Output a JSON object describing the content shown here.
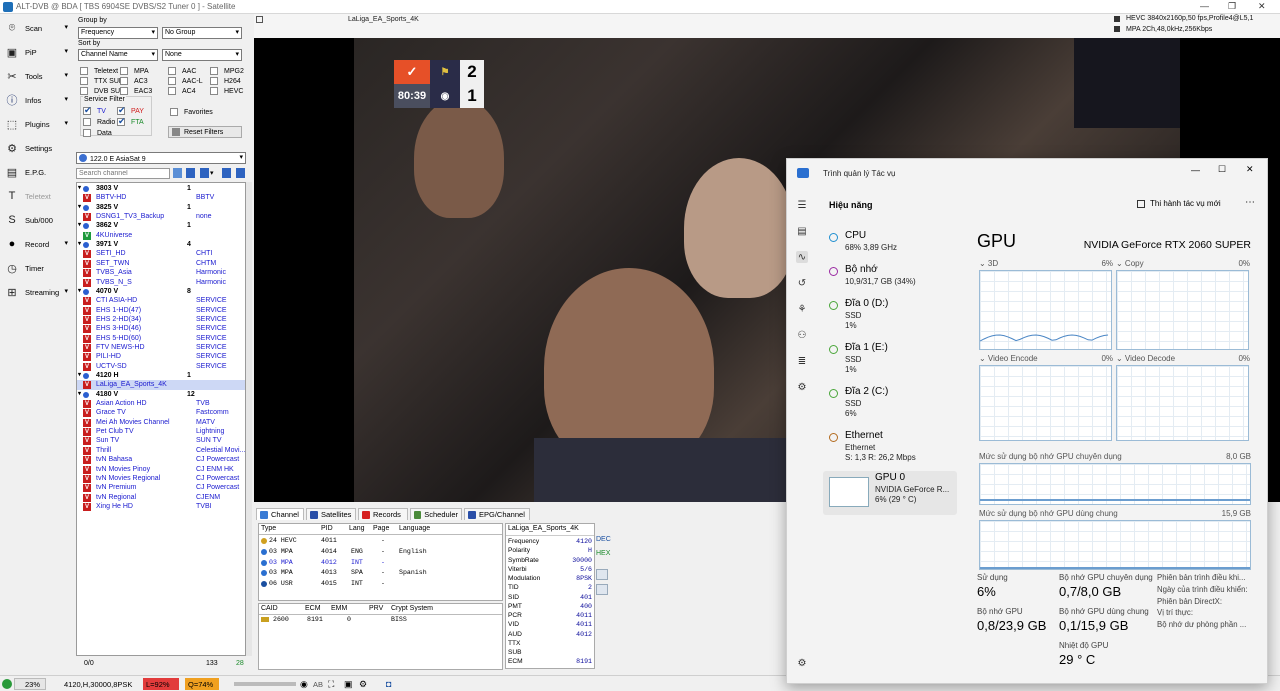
{
  "window": {
    "title": "ALT-DVB @ BDA [ TBS 6904SE DVBS/S2 Tuner 0 ] - Satellite"
  },
  "toolbar": [
    {
      "label": "Scan",
      "icon": "satellite-dish-icon",
      "arrow": true
    },
    {
      "label": "PiP",
      "icon": "pip-icon",
      "arrow": true
    },
    {
      "label": "Tools",
      "icon": "tools-icon",
      "arrow": true
    },
    {
      "label": "Infos",
      "icon": "info-icon",
      "arrow": true
    },
    {
      "label": "Plugins",
      "icon": "plugin-icon",
      "arrow": true
    },
    {
      "label": "Settings",
      "icon": "gear-icon",
      "arrow": false
    },
    {
      "label": "E.P.G.",
      "icon": "epg-icon",
      "arrow": false
    },
    {
      "label": "Teletext",
      "icon": "teletext-icon",
      "arrow": false,
      "disabled": true
    },
    {
      "label": "Sub/000",
      "icon": "subtitle-icon",
      "arrow": false
    },
    {
      "label": "Record",
      "icon": "record-icon",
      "arrow": true
    },
    {
      "label": "Timer",
      "icon": "clock-icon",
      "arrow": false
    },
    {
      "label": "Streaming",
      "icon": "network-icon",
      "arrow": true
    }
  ],
  "filters": {
    "group_by_label": "Group by",
    "group_by_value": "Frequency",
    "group_by_value2": "No Group",
    "sort_by_label": "Sort by",
    "sort_by_value": "Channel Name",
    "sort_by_value2": "None",
    "checks": [
      {
        "label": "Teletext",
        "col": 0,
        "row": 0
      },
      {
        "label": "TTX SUB",
        "col": 0,
        "row": 1
      },
      {
        "label": "DVB SUB",
        "col": 0,
        "row": 2
      },
      {
        "label": "MPA",
        "col": 1,
        "row": 0
      },
      {
        "label": "AC3",
        "col": 1,
        "row": 1
      },
      {
        "label": "EAC3",
        "col": 1,
        "row": 2
      },
      {
        "label": "AAC",
        "col": 2,
        "row": 0
      },
      {
        "label": "AAC-L",
        "col": 2,
        "row": 1
      },
      {
        "label": "AC4",
        "col": 2,
        "row": 2
      },
      {
        "label": "MPG2",
        "col": 3,
        "row": 0
      },
      {
        "label": "H264",
        "col": 3,
        "row": 1
      },
      {
        "label": "HEVC",
        "col": 3,
        "row": 2
      }
    ],
    "service_filter_label": "Service Filter",
    "service": [
      {
        "label": "TV",
        "checked": true,
        "color": "#1a1acf"
      },
      {
        "label": "PAY",
        "checked": true,
        "color": "#d01c1c"
      },
      {
        "label": "Radio",
        "checked": false,
        "color": "#000000"
      },
      {
        "label": "FTA",
        "checked": true,
        "color": "#1a8a2a"
      },
      {
        "label": "Data",
        "checked": false,
        "color": "#000000"
      }
    ],
    "favorites_label": "Favorites",
    "reset_label": "Reset Filters"
  },
  "satellite": {
    "value": "122.0 E AsiaSat 9"
  },
  "search": {
    "placeholder": "Search channel"
  },
  "channels": [
    {
      "type": "group",
      "name": "3803 V",
      "count": "1"
    },
    {
      "type": "ch",
      "tag": "V",
      "name": "BBTV-HD",
      "provider": "BBTV"
    },
    {
      "type": "group",
      "name": "3825 V",
      "count": "1"
    },
    {
      "type": "ch",
      "tag": "V",
      "name": "DSNG1_TV3_Backup",
      "provider": "none"
    },
    {
      "type": "group",
      "name": "3862 V",
      "count": "1"
    },
    {
      "type": "ch",
      "tag": "TV",
      "name": "4KUniverse",
      "provider": ""
    },
    {
      "type": "group",
      "name": "3971 V",
      "count": "4"
    },
    {
      "type": "ch",
      "tag": "V",
      "name": "SETI_HD",
      "provider": "CHTI"
    },
    {
      "type": "ch",
      "tag": "V",
      "name": "SET_TWN",
      "provider": "CHTM"
    },
    {
      "type": "ch",
      "tag": "V",
      "name": "TVBS_Asia",
      "provider": "Harmonic"
    },
    {
      "type": "ch",
      "tag": "V",
      "name": "TVBS_N_S",
      "provider": "Harmonic"
    },
    {
      "type": "group",
      "name": "4070 V",
      "count": "8"
    },
    {
      "type": "ch",
      "tag": "V",
      "name": "CTI ASIA-HD",
      "provider": "SERVICE"
    },
    {
      "type": "ch",
      "tag": "V",
      "name": "EHS 1-HD(47)",
      "provider": "SERVICE"
    },
    {
      "type": "ch",
      "tag": "V",
      "name": "EHS 2-HD(34)",
      "provider": "SERVICE"
    },
    {
      "type": "ch",
      "tag": "V",
      "name": "EHS 3-HD(46)",
      "provider": "SERVICE"
    },
    {
      "type": "ch",
      "tag": "V",
      "name": "EHS 5-HD(60)",
      "provider": "SERVICE"
    },
    {
      "type": "ch",
      "tag": "V",
      "name": "FTV NEWS-HD",
      "provider": "SERVICE"
    },
    {
      "type": "ch",
      "tag": "V",
      "name": "PILI-HD",
      "provider": "SERVICE"
    },
    {
      "type": "ch",
      "tag": "V",
      "name": "UCTV-SD",
      "provider": "SERVICE"
    },
    {
      "type": "group",
      "name": "4120 H",
      "count": "1"
    },
    {
      "type": "ch",
      "tag": "V",
      "name": "LaLiga_EA_Sports_4K",
      "provider": "",
      "selected": true
    },
    {
      "type": "group",
      "name": "4180 V",
      "count": "12"
    },
    {
      "type": "ch",
      "tag": "V",
      "name": "Asian Action HD",
      "provider": "TVB"
    },
    {
      "type": "ch",
      "tag": "V",
      "name": "Grace TV",
      "provider": "Fastcomm"
    },
    {
      "type": "ch",
      "tag": "V",
      "name": "Mei Ah Movies Channel",
      "provider": "MATV"
    },
    {
      "type": "ch",
      "tag": "V",
      "name": "Pet Club TV",
      "provider": "Lightning"
    },
    {
      "type": "ch",
      "tag": "V",
      "name": "Sun TV",
      "provider": "SUN TV"
    },
    {
      "type": "ch",
      "tag": "V",
      "name": "Thrill",
      "provider": "Celestial Movi..."
    },
    {
      "type": "ch",
      "tag": "V",
      "name": "tvN Bahasa",
      "provider": "CJ Powercast"
    },
    {
      "type": "ch",
      "tag": "V",
      "name": "tvN Movies Pinoy",
      "provider": "CJ ENM HK"
    },
    {
      "type": "ch",
      "tag": "V",
      "name": "tvN Movies Regional",
      "provider": "CJ Powercast"
    },
    {
      "type": "ch",
      "tag": "V",
      "name": "tvN Premium",
      "provider": "CJ Powercast"
    },
    {
      "type": "ch",
      "tag": "V",
      "name": "tvN Regional",
      "provider": "CJENM"
    },
    {
      "type": "ch",
      "tag": "V",
      "name": "Xing He HD",
      "provider": "TVBI"
    }
  ],
  "list_status": {
    "left": "0/0",
    "mid": "133",
    "right": "28"
  },
  "video": {
    "title": "LaLiga_EA_Sports_4K",
    "codec_video": "HEVC 3840x2160p,50 fps,Profile4@L5,1",
    "codec_audio": "MPA 2Ch,48,0kHz,256Kbps",
    "score_home": "2",
    "score_away": "1",
    "clock": "80:39"
  },
  "tabs": [
    {
      "label": "Channel",
      "color": "#3a7bd5",
      "active": true
    },
    {
      "label": "Satellites",
      "color": "#2a4fa8"
    },
    {
      "label": "Records",
      "color": "#d62020"
    },
    {
      "label": "Scheduler",
      "color": "#4a8a3a"
    },
    {
      "label": "EPG/Channel",
      "color": "#2a4fa8"
    }
  ],
  "pids": {
    "headers": [
      "Type",
      "PID",
      "Lang",
      "Page",
      "Language"
    ],
    "rows": [
      {
        "type": "24 HEVC",
        "pid": "4011",
        "lang": "",
        "page": "-",
        "language": "",
        "color": "#000000"
      },
      {
        "type": "03 MPA",
        "pid": "4014",
        "lang": "ENG",
        "page": "-",
        "language": "English",
        "color": "#000000"
      },
      {
        "type": "03 MPA",
        "pid": "4012",
        "lang": "INT",
        "page": "-",
        "language": "",
        "color": "#1a1acf"
      },
      {
        "type": "03 MPA",
        "pid": "4013",
        "lang": "SPA",
        "page": "-",
        "language": "Spanish",
        "color": "#000000"
      },
      {
        "type": "06 USR",
        "pid": "4015",
        "lang": "INT",
        "page": "-",
        "language": "",
        "color": "#000000"
      }
    ]
  },
  "caids": {
    "headers": [
      "CAID",
      "ECM",
      "EMM",
      "PRV",
      "Crypt System"
    ],
    "rows": [
      {
        "caid": "2600",
        "ecm": "8191",
        "emm": "0",
        "prv": "",
        "crypt": "BISS"
      }
    ]
  },
  "info": {
    "title": "LaLiga_EA_Sports_4K",
    "rows": [
      {
        "k": "Frequency",
        "v": "4120"
      },
      {
        "k": "Polarity",
        "v": "H"
      },
      {
        "k": "SymbRate",
        "v": "30000"
      },
      {
        "k": "Viterbi",
        "v": "5/6"
      },
      {
        "k": "Modulation",
        "v": "8PSK"
      },
      {
        "k": "TID",
        "v": "2"
      },
      {
        "k": "SID",
        "v": "401"
      },
      {
        "k": "PMT",
        "v": "400"
      },
      {
        "k": "PCR",
        "v": "4011"
      },
      {
        "k": "VID",
        "v": "4011"
      },
      {
        "k": "AUD",
        "v": "4012"
      },
      {
        "k": "TTX",
        "v": ""
      },
      {
        "k": "SUB",
        "v": ""
      },
      {
        "k": "ECM",
        "v": "8191"
      }
    ],
    "dec": "DEC",
    "hex": "HEX"
  },
  "status": {
    "signal": "23%",
    "tune": "4120,H,30000,8PSK",
    "level": "L=92%",
    "quality": "Q=74%",
    "ab": "AB"
  },
  "taskmgr": {
    "title": "Trình quản lý Tác vụ",
    "section": "Hiệu năng",
    "run_task": "Thi hành tác vụ mới",
    "items": [
      {
        "name": "CPU",
        "sub1": "68% 3,89 GHz",
        "sub2": "",
        "sub3": "",
        "color": "#1f8fd0"
      },
      {
        "name": "Bộ nhớ",
        "sub1": "10,9/31,7 GB (34%)",
        "sub2": "",
        "sub3": "",
        "color": "#9b2ba3"
      },
      {
        "name": "Đĩa 0 (D:)",
        "sub1": "SSD",
        "sub2": "1%",
        "sub3": "",
        "color": "#4aa63a"
      },
      {
        "name": "Đĩa 1 (E:)",
        "sub1": "SSD",
        "sub2": "1%",
        "sub3": "",
        "color": "#4aa63a"
      },
      {
        "name": "Đĩa 2 (C:)",
        "sub1": "SSD",
        "sub2": "6%",
        "sub3": "",
        "color": "#4aa63a"
      },
      {
        "name": "Ethernet",
        "sub1": "Ethernet",
        "sub2": "S: 1,3 R: 26,2 Mbps",
        "sub3": "",
        "color": "#b36b1f"
      },
      {
        "name": "GPU 0",
        "sub1": "NVIDIA GeForce R...",
        "sub2": "6% (29 ° C)",
        "sub3": "",
        "color": "#1f8fd0"
      }
    ],
    "gpu_title": "GPU",
    "gpu_name": "NVIDIA GeForce RTX 2060 SUPER",
    "engines": [
      {
        "label": "3D",
        "pct": "6%"
      },
      {
        "label": "Copy",
        "pct": "0%"
      },
      {
        "label": "Video Encode",
        "pct": "0%"
      },
      {
        "label": "Video Decode",
        "pct": "0%"
      }
    ],
    "dedicated_label": "Mức sử dụng bộ nhớ GPU chuyên dụng",
    "dedicated_max": "8,0 GB",
    "shared_label": "Mức sử dụng bộ nhớ GPU dùng chung",
    "shared_max": "15,9 GB",
    "stats": [
      {
        "k": "Sử dụng",
        "v": "6%"
      },
      {
        "k": "Bộ nhớ GPU chuyên dụng",
        "v": "0,7/8,0 GB"
      },
      {
        "k": "Bộ nhớ GPU",
        "v": "0,8/23,9 GB"
      },
      {
        "k": "Bộ nhớ GPU dùng chung",
        "v": "0,1/15,9 GB"
      },
      {
        "k": "Nhiệt độ GPU",
        "v": "29 ° C"
      }
    ],
    "details": [
      "Phiên bản trình điều khi...",
      "Ngày của trình điều khiển:",
      "Phiên bản DirectX:",
      "Vị trí thực:",
      "Bộ nhớ dư phòng phần ..."
    ]
  }
}
